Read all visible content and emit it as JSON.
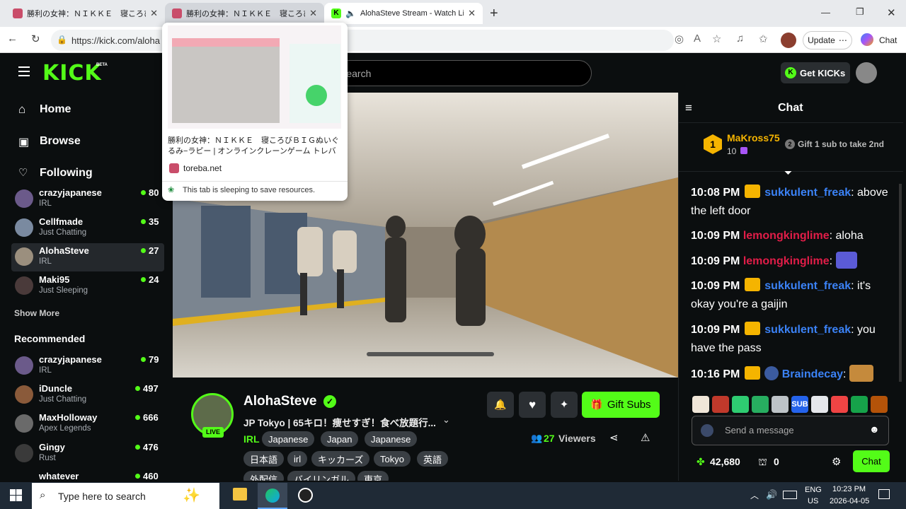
{
  "browser": {
    "tabs": [
      {
        "title": "勝利の女神：ＮＩＫＫＥ　寝ころび"
      },
      {
        "title": "勝利の女神：ＮＩＫＫＥ　寝ころび"
      },
      {
        "title": "AlohaSteve Stream - Watch Li"
      }
    ],
    "url": "https://kick.com/aloha",
    "update_label": "Update",
    "chat_label": "Chat"
  },
  "tab_preview": {
    "title": "勝利の女神：ＮＩＫＫＥ　寝ころびＢＩＧぬいぐるみ−ラピー | オンラインクレーンゲーム トレバ",
    "site": "toreba.net",
    "sleep_note": "This tab is sleeping to save resources."
  },
  "nav": {
    "search_placeholder": "Search",
    "get_kicks": "Get KICKs",
    "home": "Home",
    "browse": "Browse",
    "following": "Following",
    "show_more": "Show More",
    "recommended": "Recommended"
  },
  "following_channels": [
    {
      "name": "crazyjapanese",
      "category": "IRL",
      "viewers": "80"
    },
    {
      "name": "Cellfmade",
      "category": "Just Chatting",
      "viewers": "35"
    },
    {
      "name": "AlohaSteve",
      "category": "IRL",
      "viewers": "27"
    },
    {
      "name": "Maki95",
      "category": "Just Sleeping",
      "viewers": "24"
    }
  ],
  "recommended_channels": [
    {
      "name": "crazyjapanese",
      "category": "IRL",
      "viewers": "79"
    },
    {
      "name": "iDuncle",
      "category": "Just Chatting",
      "viewers": "497"
    },
    {
      "name": "MaxHolloway",
      "category": "Apex Legends",
      "viewers": "666"
    },
    {
      "name": "Gingy",
      "category": "Rust",
      "viewers": "476"
    },
    {
      "name": "whatever",
      "category": "",
      "viewers": "460"
    }
  ],
  "stream": {
    "streamer": "AlohaSteve",
    "live_badge": "LIVE",
    "title": "JP Tokyo | 65キロ！痩せすぎ！食べ放題行...",
    "category": "IRL",
    "tags_row1": [
      "Japanese",
      "Japan",
      "Japanese"
    ],
    "tags_row2": [
      "日本語",
      "irl",
      "キッカーズ",
      "Tokyo",
      "英語"
    ],
    "tags_row3": [
      "外配信",
      "バイリンガル",
      "東京"
    ],
    "viewers": "27",
    "viewers_label": "Viewers",
    "gift_subs": "Gift Subs"
  },
  "chat": {
    "header": "Chat",
    "top_gifter": {
      "rank": "1",
      "name": "MaKross75",
      "count": "10"
    },
    "gift_prompt": "Gift 1 sub to take 2nd",
    "messages": [
      {
        "time": "10:08 PM",
        "user": "sukkulent_freak",
        "color": "#3b82f6",
        "text": ": above the left door"
      },
      {
        "time": "10:09 PM",
        "user": "lemongkinglime",
        "color": "#e11d48",
        "text": ": aloha"
      },
      {
        "time": "10:09 PM",
        "user": "lemongkinglime",
        "color": "#e11d48",
        "text": ":"
      },
      {
        "time": "10:09 PM",
        "user": "sukkulent_freak",
        "color": "#3b82f6",
        "text": ": it's okay you're a gaijin"
      },
      {
        "time": "10:09 PM",
        "user": "sukkulent_freak",
        "color": "#3b82f6",
        "text": ": you have the pass"
      },
      {
        "time": "10:16 PM",
        "user": "Braindecay",
        "color": "#3b82f6",
        "text": ":"
      }
    ],
    "send_placeholder": "Send a message",
    "kicks_balance": "42,680",
    "sub_balance": "0",
    "chat_button": "Chat"
  },
  "taskbar": {
    "search_placeholder": "Type here to search",
    "lang": "ENG",
    "region": "US",
    "time": "10:23 PM",
    "date": "2026-04-05"
  },
  "colors": {
    "kick_green": "#53fc18",
    "sidebar_bg": "#0b0e0f"
  }
}
